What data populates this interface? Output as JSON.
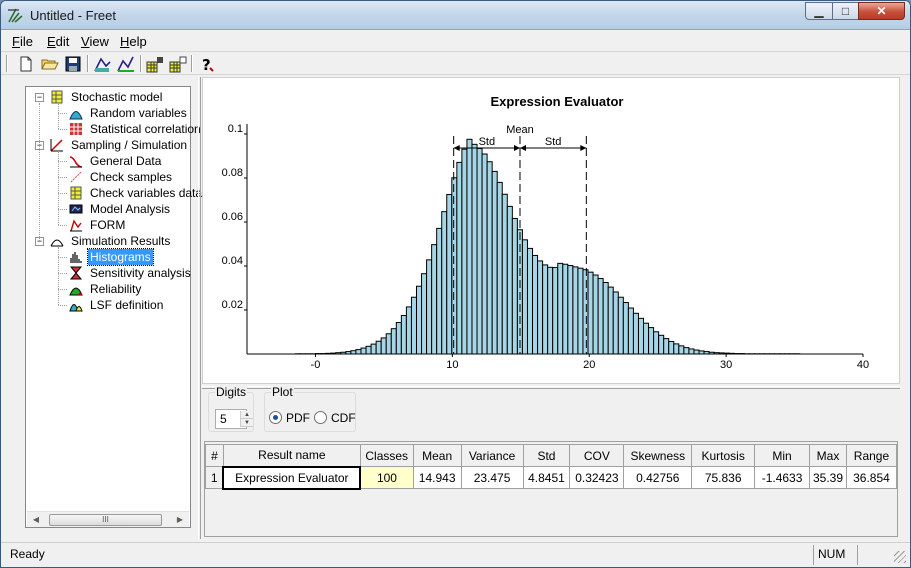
{
  "window": {
    "title": "Untitled - Freet",
    "minimize_icon": "minimize-icon",
    "maximize_icon": "maximize-icon",
    "close_icon": "close-icon"
  },
  "menu": [
    {
      "label": "File",
      "key": "F"
    },
    {
      "label": "Edit",
      "key": "E"
    },
    {
      "label": "View",
      "key": "V"
    },
    {
      "label": "Help",
      "key": "H"
    }
  ],
  "toolbar": {
    "icons": [
      "new-file-icon",
      "open-folder-icon",
      "save-disk-icon",
      "sampling-icon",
      "simulation-icon",
      "grid-add-icon",
      "grid-remove-icon",
      "help-icon"
    ]
  },
  "tree": {
    "items": [
      {
        "label": "Stochastic model",
        "level": 0,
        "icon": "stochastic-model-icon",
        "expander": "−"
      },
      {
        "label": "Random variables",
        "level": 1,
        "icon": "random-variables-icon"
      },
      {
        "label": "Statistical correlation",
        "level": 1,
        "icon": "correlation-grid-icon"
      },
      {
        "label": "Sampling / Simulation",
        "level": 0,
        "icon": "sampling-icon",
        "expander": "−"
      },
      {
        "label": "General Data",
        "level": 1,
        "icon": "general-data-icon"
      },
      {
        "label": "Check samples",
        "level": 1,
        "icon": "check-samples-icon"
      },
      {
        "label": "Check variables data",
        "level": 1,
        "icon": "check-variables-icon"
      },
      {
        "label": "Model Analysis",
        "level": 1,
        "icon": "model-analysis-icon"
      },
      {
        "label": "FORM",
        "level": 1,
        "icon": "form-icon"
      },
      {
        "label": "Simulation Results",
        "level": 0,
        "icon": "simulation-results-icon",
        "expander": "−"
      },
      {
        "label": "Histograms",
        "level": 1,
        "icon": "histogram-icon",
        "selected": true
      },
      {
        "label": "Sensitivity analysis",
        "level": 1,
        "icon": "sensitivity-icon"
      },
      {
        "label": "Reliability",
        "level": 1,
        "icon": "reliability-icon"
      },
      {
        "label": "LSF definition",
        "level": 1,
        "icon": "lsf-icon"
      }
    ],
    "scroll_thumb_text": "III"
  },
  "chart_data": {
    "type": "bar",
    "title": "Expression Evaluator",
    "xlim": [
      -5,
      40
    ],
    "ylim": [
      0,
      0.11
    ],
    "xticks": [
      {
        "v": 0,
        "label": "-0"
      },
      {
        "v": 10,
        "label": "10"
      },
      {
        "v": 20,
        "label": "20"
      },
      {
        "v": 30,
        "label": "30"
      },
      {
        "v": 40,
        "label": "40"
      }
    ],
    "yticks": [
      {
        "v": 0.02,
        "label": "0.02"
      },
      {
        "v": 0.04,
        "label": "0.04"
      },
      {
        "v": 0.06,
        "label": "0.06"
      },
      {
        "v": 0.08,
        "label": "0.08"
      },
      {
        "v": 0.1,
        "label": "0.1"
      }
    ],
    "bin_start": -1.4633,
    "bin_width": 0.36854,
    "values": [
      0.0001,
      0.0001,
      0.0001,
      0.0001,
      0.0002,
      0.0002,
      0.0003,
      0.0004,
      0.0006,
      0.0008,
      0.0011,
      0.0015,
      0.002,
      0.0027,
      0.0035,
      0.0045,
      0.0058,
      0.0073,
      0.0092,
      0.0115,
      0.0143,
      0.0175,
      0.0214,
      0.0258,
      0.0308,
      0.0365,
      0.0428,
      0.0497,
      0.0571,
      0.0647,
      0.0725,
      0.0801,
      0.0871,
      0.0931,
      0.0976,
      0.0953,
      0.0934,
      0.0909,
      0.0874,
      0.083,
      0.078,
      0.0726,
      0.0671,
      0.0616,
      0.0565,
      0.0519,
      0.048,
      0.0448,
      0.0423,
      0.0405,
      0.0394,
      0.0393,
      0.0412,
      0.0408,
      0.0402,
      0.0396,
      0.039,
      0.0383,
      0.0372,
      0.0359,
      0.0343,
      0.0325,
      0.0304,
      0.0282,
      0.0258,
      0.0234,
      0.0209,
      0.0185,
      0.0162,
      0.014,
      0.012,
      0.0101,
      0.0085,
      0.007,
      0.0057,
      0.0046,
      0.0037,
      0.0029,
      0.0023,
      0.0018,
      0.0014,
      0.0011,
      0.0008,
      0.0006,
      0.0005,
      0.0004,
      0.0003,
      0.0002,
      0.0002,
      0.0001,
      0.0001,
      0.0001,
      0.0001,
      0.0001,
      0.0001,
      0.0001,
      0.0001,
      0.0001,
      0.0001,
      0.0001
    ],
    "bar_color": "#a6d6e6",
    "mean": 14.943,
    "std": 4.8451,
    "mean_label": "Mean",
    "std_label": "Std"
  },
  "controls": {
    "digits": {
      "title": "Digits",
      "value": "5"
    },
    "plot": {
      "title": "Plot",
      "options": [
        {
          "label": "PDF",
          "checked": true
        },
        {
          "label": "CDF",
          "checked": false
        }
      ]
    }
  },
  "results_table": {
    "headers": [
      "#",
      "Result name",
      "Classes",
      "Mean",
      "Variance",
      "Std",
      "COV",
      "Skewness",
      "Kurtosis",
      "Min",
      "Max",
      "Range"
    ],
    "rows": [
      [
        "1",
        "Expression Evaluator",
        "100",
        "14.943",
        "23.475",
        "4.8451",
        "0.32423",
        "0.42756",
        "75.836",
        "-1.4633",
        "35.39",
        "36.854"
      ]
    ]
  },
  "status": {
    "text": "Ready",
    "num": "NUM"
  }
}
